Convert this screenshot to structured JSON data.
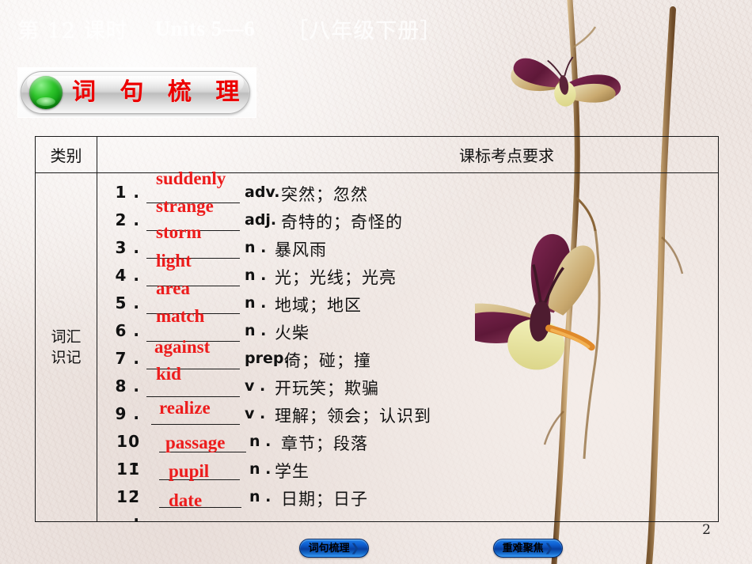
{
  "header": {
    "lesson": "第 12 课时",
    "units": "Units 5—6",
    "grade": "［八年级下册］"
  },
  "section_badge": {
    "label": "词 句 梳 理",
    "dot_color": "#1aa81a",
    "text_color": "#ec0000"
  },
  "table": {
    "columns": [
      "类别",
      "课标考点要求"
    ],
    "row_label": [
      "词汇",
      "识记"
    ],
    "entries": [
      {
        "num": "1 .",
        "answer": "suddenly",
        "pos": "adv.",
        "definition": "突然；忽然"
      },
      {
        "num": "2 .",
        "answer": "strange",
        "pos": "adj.",
        "definition": "奇特的；奇怪的"
      },
      {
        "num": "3 .",
        "answer": "storm",
        "pos": "n .",
        "definition": "暴风雨"
      },
      {
        "num": "4 .",
        "answer": "light",
        "pos": "n .",
        "definition": "光；光线；光亮"
      },
      {
        "num": "5 .",
        "answer": "area",
        "pos": "n .",
        "definition": "地域；地区"
      },
      {
        "num": "6 .",
        "answer": "match",
        "pos": "n .",
        "definition": "火柴"
      },
      {
        "num": "7 .",
        "answer": "against",
        "pos": "prep.",
        "definition": "倚；碰；撞"
      },
      {
        "num": "8 .",
        "answer": "kid",
        "pos": "v .",
        "definition": "开玩笑；欺骗"
      },
      {
        "num": "9 .",
        "answer": "realize",
        "pos": "v .",
        "definition": "理解；领会；认识到"
      },
      {
        "num": "10 .",
        "answer": "passage",
        "pos": "n .",
        "definition": "章节；段落"
      },
      {
        "num": "11 .",
        "answer": "pupil",
        "pos": "n .",
        "definition": "学生"
      },
      {
        "num": "12 .",
        "answer": "date",
        "pos": "n .",
        "definition": "日期；日子"
      }
    ]
  },
  "nav": {
    "left_label": "词句梳理",
    "right_label": "重难聚焦",
    "chevron": "❯",
    "color": "#0e5fd0"
  },
  "page_number": "2"
}
